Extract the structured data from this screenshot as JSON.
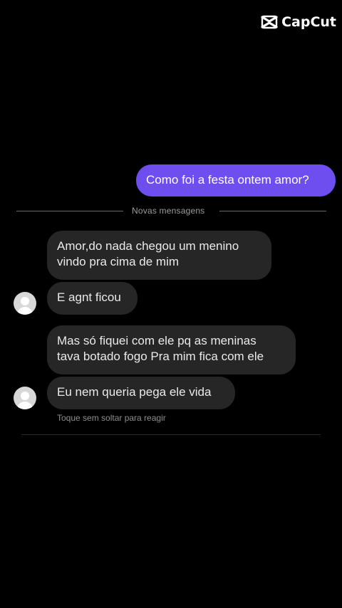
{
  "watermark": {
    "text": "CapCut",
    "icon": "capcut-logo-icon"
  },
  "outgoing": {
    "text": "Como foi a festa ontem amor?"
  },
  "divider": {
    "label": "Novas mensagens"
  },
  "incoming": [
    {
      "line1": "Amor,do nada chegou um menino",
      "line2": "vindo pra cima de mim"
    },
    {
      "text": "E agnt ficou"
    },
    {
      "line1": "Mas só fiquei com ele pq as meninas",
      "line2": "tava botado fogo Pra mim fica com ele"
    },
    {
      "text": "Eu nem queria pega ele vida"
    }
  ],
  "hint": {
    "text": "Toque sem soltar para reagir"
  },
  "colors": {
    "background": "#000000",
    "outgoing_bubble": "#6f4ef0",
    "incoming_bubble": "#262626"
  }
}
